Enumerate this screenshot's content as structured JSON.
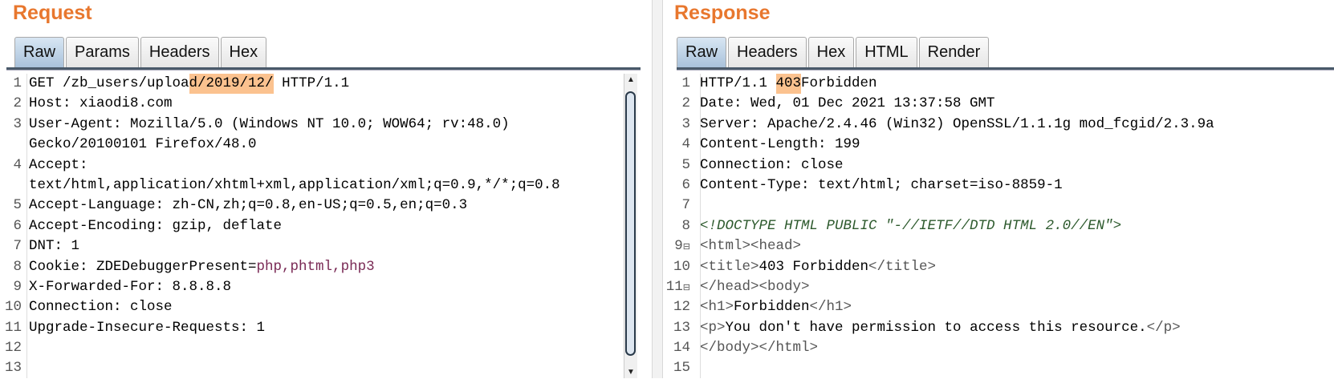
{
  "request": {
    "title": "Request",
    "tabs": [
      {
        "label": "Raw",
        "active": true
      },
      {
        "label": "Params"
      },
      {
        "label": "Headers"
      },
      {
        "label": "Hex"
      }
    ],
    "lines": [
      {
        "n": "1",
        "segs": [
          {
            "t": "GET /zb_users/uploa"
          },
          {
            "t": "d/2019/12/",
            "c": "hl"
          },
          {
            "t": " HTTP/1.1"
          }
        ]
      },
      {
        "n": "2",
        "segs": [
          {
            "t": "Host: xiaodi8.com"
          }
        ]
      },
      {
        "n": "3",
        "segs": [
          {
            "t": "User-Agent: Mozilla/5.0 (Windows NT 10.0; WOW64; rv:48.0)"
          }
        ]
      },
      {
        "n": "",
        "segs": [
          {
            "t": "Gecko/20100101 Firefox/48.0"
          }
        ]
      },
      {
        "n": "4",
        "segs": [
          {
            "t": "Accept:"
          }
        ]
      },
      {
        "n": "",
        "segs": [
          {
            "t": "text/html,application/xhtml+xml,application/xml;q=0.9,*/*;q=0.8"
          }
        ]
      },
      {
        "n": "5",
        "segs": [
          {
            "t": "Accept-Language: zh-CN,zh;q=0.8,en-US;q=0.5,en;q=0.3"
          }
        ]
      },
      {
        "n": "6",
        "segs": [
          {
            "t": "Accept-Encoding: gzip, deflate"
          }
        ]
      },
      {
        "n": "7",
        "segs": [
          {
            "t": "DNT: 1"
          }
        ]
      },
      {
        "n": "8",
        "segs": [
          {
            "t": "Cookie: ZDEDebuggerPresent="
          },
          {
            "t": "php,phtml,php3",
            "c": "param"
          }
        ]
      },
      {
        "n": "9",
        "segs": [
          {
            "t": "X-Forwarded-For: 8.8.8.8"
          }
        ]
      },
      {
        "n": "10",
        "segs": [
          {
            "t": "Connection: close"
          }
        ]
      },
      {
        "n": "11",
        "segs": [
          {
            "t": "Upgrade-Insecure-Requests: 1"
          }
        ]
      },
      {
        "n": "12",
        "segs": []
      },
      {
        "n": "13",
        "segs": []
      }
    ]
  },
  "response": {
    "title": "Response",
    "tabs": [
      {
        "label": "Raw",
        "active": true
      },
      {
        "label": "Headers"
      },
      {
        "label": "Hex"
      },
      {
        "label": "HTML"
      },
      {
        "label": "Render"
      }
    ],
    "lines": [
      {
        "n": "1",
        "segs": [
          {
            "t": "HTTP/1.1 "
          },
          {
            "t": "403",
            "c": "hl"
          },
          {
            "t": "Forbidden"
          }
        ]
      },
      {
        "n": "2",
        "segs": [
          {
            "t": "Date: Wed, 01 Dec 2021 13:37:58 GMT"
          }
        ]
      },
      {
        "n": "3",
        "segs": [
          {
            "t": "Server: Apache/2.4.46 (Win32) OpenSSL/1.1.1g mod_fcgid/2.3.9a"
          }
        ]
      },
      {
        "n": "4",
        "segs": [
          {
            "t": "Content-Length: 199"
          }
        ]
      },
      {
        "n": "5",
        "segs": [
          {
            "t": "Connection: close"
          }
        ]
      },
      {
        "n": "6",
        "segs": [
          {
            "t": "Content-Type: text/html; charset=iso-8859-1"
          }
        ]
      },
      {
        "n": "7",
        "segs": []
      },
      {
        "n": "8",
        "segs": [
          {
            "t": "<!DOCTYPE HTML PUBLIC \"-//IETF//DTD HTML 2.0//EN\">",
            "c": "doctype"
          }
        ]
      },
      {
        "n": "9",
        "fold": true,
        "segs": [
          {
            "t": "<html><head>",
            "c": "tag"
          }
        ]
      },
      {
        "n": "10",
        "segs": [
          {
            "t": "<title>",
            "c": "tag"
          },
          {
            "t": "403 Forbidden"
          },
          {
            "t": "</title>",
            "c": "tag"
          }
        ]
      },
      {
        "n": "11",
        "fold": true,
        "segs": [
          {
            "t": "</head><body>",
            "c": "tag"
          }
        ]
      },
      {
        "n": "12",
        "segs": [
          {
            "t": "<h1>",
            "c": "tag"
          },
          {
            "t": "Forbidden"
          },
          {
            "t": "</h1>",
            "c": "tag"
          }
        ]
      },
      {
        "n": "13",
        "segs": [
          {
            "t": "<p>",
            "c": "tag"
          },
          {
            "t": "You don't have permission to access this resource."
          },
          {
            "t": "</p>",
            "c": "tag"
          }
        ]
      },
      {
        "n": "14",
        "segs": [
          {
            "t": "</body></html>",
            "c": "tag"
          }
        ]
      },
      {
        "n": "15",
        "segs": []
      }
    ]
  },
  "colors": {
    "title": "#e8772e",
    "highlight": "#fbc28f",
    "active_tab": "#a9c2db"
  }
}
